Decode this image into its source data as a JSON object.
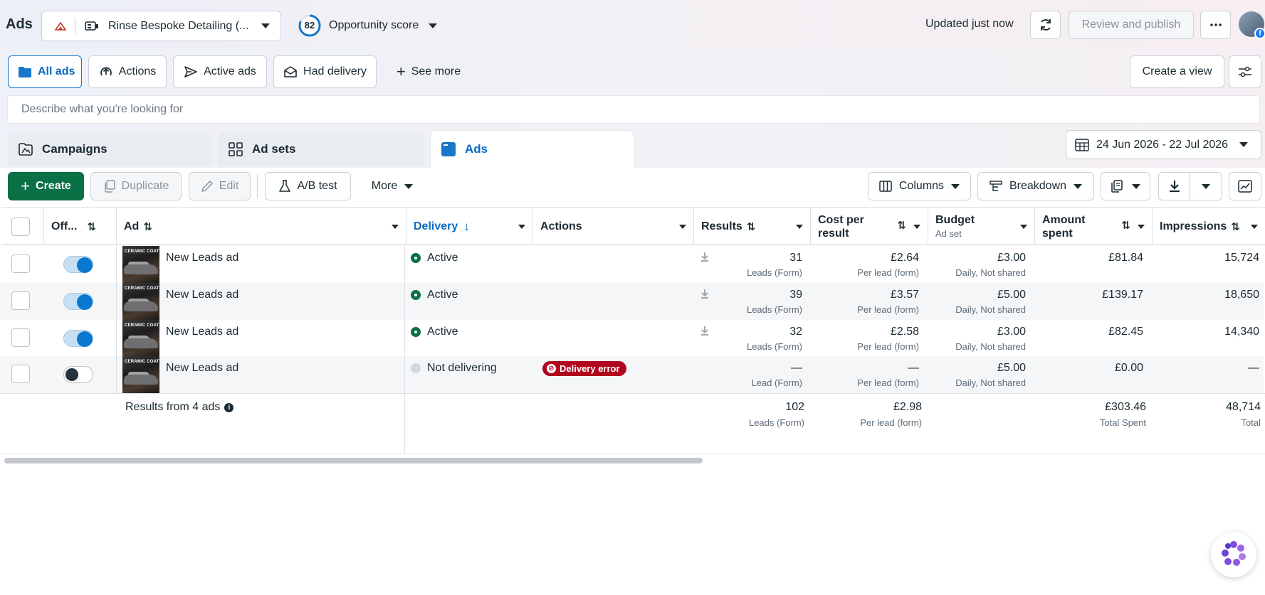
{
  "header": {
    "title": "Ads",
    "account_name": "Rinse Bespoke Detailing (...",
    "opportunity_score": "82",
    "opportunity_label": "Opportunity score",
    "updated": "Updated just now",
    "review_publish": "Review and publish"
  },
  "filters": {
    "all_ads": "All ads",
    "actions": "Actions",
    "active_ads": "Active ads",
    "had_delivery": "Had delivery",
    "see_more": "See more",
    "create_view": "Create a view"
  },
  "search": {
    "placeholder": "Describe what you're looking for"
  },
  "tabs": {
    "campaigns": "Campaigns",
    "ad_sets": "Ad sets",
    "ads": "Ads"
  },
  "date_range": "24 Jun 2026 - 22 Jul 2026",
  "toolbar": {
    "create": "Create",
    "duplicate": "Duplicate",
    "edit": "Edit",
    "ab_test": "A/B test",
    "more": "More",
    "columns": "Columns",
    "breakdown": "Breakdown"
  },
  "columns": {
    "off_on": "Off...",
    "ad": "Ad",
    "delivery": "Delivery",
    "actions": "Actions",
    "results": "Results",
    "cost_line1": "Cost per",
    "cost_line2": "result",
    "budget": "Budget",
    "budget_sub": "Ad set",
    "amount_line1": "Amount",
    "amount_line2": "spent",
    "impressions": "Impressions"
  },
  "rows": [
    {
      "on": true,
      "ad": "New Leads ad",
      "delivery": "Active",
      "results": "31",
      "results_sub": "Leads (Form)",
      "cost": "£2.64",
      "cost_sub": "Per lead (form)",
      "budget": "£3.00",
      "budget_sub": "Daily, Not shared",
      "spent": "£81.84",
      "impressions": "15,724",
      "thumb_text": "CERAMIC COATING"
    },
    {
      "on": true,
      "ad": "New Leads ad",
      "delivery": "Active",
      "results": "39",
      "results_sub": "Leads (Form)",
      "cost": "£3.57",
      "cost_sub": "Per lead (form)",
      "budget": "£5.00",
      "budget_sub": "Daily, Not shared",
      "spent": "£139.17",
      "impressions": "18,650",
      "thumb_text": "CERAMIC COATING"
    },
    {
      "on": true,
      "ad": "New Leads ad",
      "delivery": "Active",
      "results": "32",
      "results_sub": "Leads (Form)",
      "cost": "£2.58",
      "cost_sub": "Per lead (form)",
      "budget": "£3.00",
      "budget_sub": "Daily, Not shared",
      "spent": "£82.45",
      "impressions": "14,340",
      "thumb_text": "CERAMIC COATING"
    },
    {
      "on": false,
      "ad": "New Leads ad",
      "delivery": "Not delivering",
      "action_badge": "Delivery error",
      "results": "—",
      "results_sub": "Lead (Form)",
      "cost": "—",
      "cost_sub": "Per lead (form)",
      "budget": "£5.00",
      "budget_sub": "Daily, Not shared",
      "spent": "£0.00",
      "impressions": "—",
      "thumb_text": "CERAMIC COATING"
    }
  ],
  "summary": {
    "label": "Results from 4 ads",
    "results": "102",
    "results_sub": "Leads (Form)",
    "cost": "£2.98",
    "cost_sub": "Per lead (form)",
    "spent": "£303.46",
    "spent_sub": "Total Spent",
    "impressions": "48,714",
    "impressions_sub": "Total"
  },
  "colors": {
    "brand_green": "#0a7046",
    "accent_blue": "#0a6ac1",
    "error_red": "#b1061e"
  }
}
